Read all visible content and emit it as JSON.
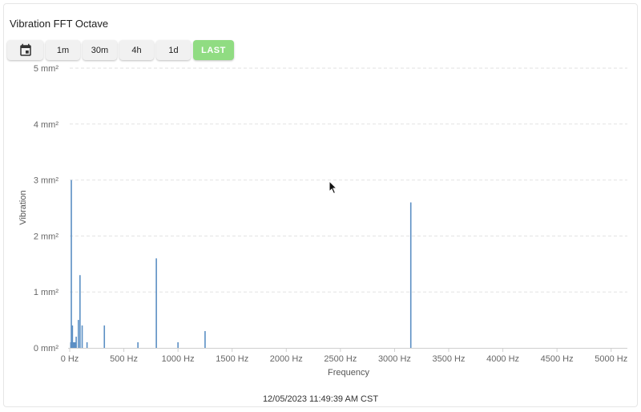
{
  "widget": {
    "title": "Vibration FFT Octave",
    "timestamp": "12/05/2023 11:49:39 AM CST"
  },
  "toolbar": {
    "calendar_icon": "calendar-icon",
    "range_buttons": [
      "1m",
      "30m",
      "4h",
      "1d"
    ],
    "last_label": "LAST",
    "last_color": "#90dc82"
  },
  "chart_data": {
    "type": "bar",
    "xlabel": "Frequency",
    "ylabel": "Vibration",
    "xlim": [
      0,
      5150
    ],
    "ylim": [
      0,
      5
    ],
    "x_ticks": [
      0,
      500,
      1000,
      1500,
      2000,
      2500,
      3000,
      3500,
      4000,
      4500,
      5000
    ],
    "x_tick_labels": [
      "0 Hz",
      "500 Hz",
      "1000 Hz",
      "1500 Hz",
      "2000 Hz",
      "2500 Hz",
      "3000 Hz",
      "3500 Hz",
      "4000 Hz",
      "4500 Hz",
      "5000 Hz"
    ],
    "y_ticks": [
      0,
      1,
      2,
      3,
      4,
      5
    ],
    "y_tick_labels": [
      "0 mm²",
      "1 mm²",
      "2 mm²",
      "3 mm²",
      "4 mm²",
      "5 mm²"
    ],
    "grid": true,
    "bar_color": "#5b8fc4",
    "series": [
      {
        "x": [
          10,
          15,
          20,
          25,
          30,
          35,
          40,
          50,
          60,
          80,
          95,
          115,
          160,
          320,
          630,
          800,
          1000,
          1250,
          3150
        ],
        "values": [
          0.1,
          3.0,
          0.1,
          0.4,
          0.1,
          0.1,
          0.1,
          0.1,
          0.2,
          0.5,
          1.3,
          0.4,
          0.1,
          0.4,
          0.1,
          1.6,
          0.1,
          0.3,
          2.6
        ]
      }
    ]
  }
}
